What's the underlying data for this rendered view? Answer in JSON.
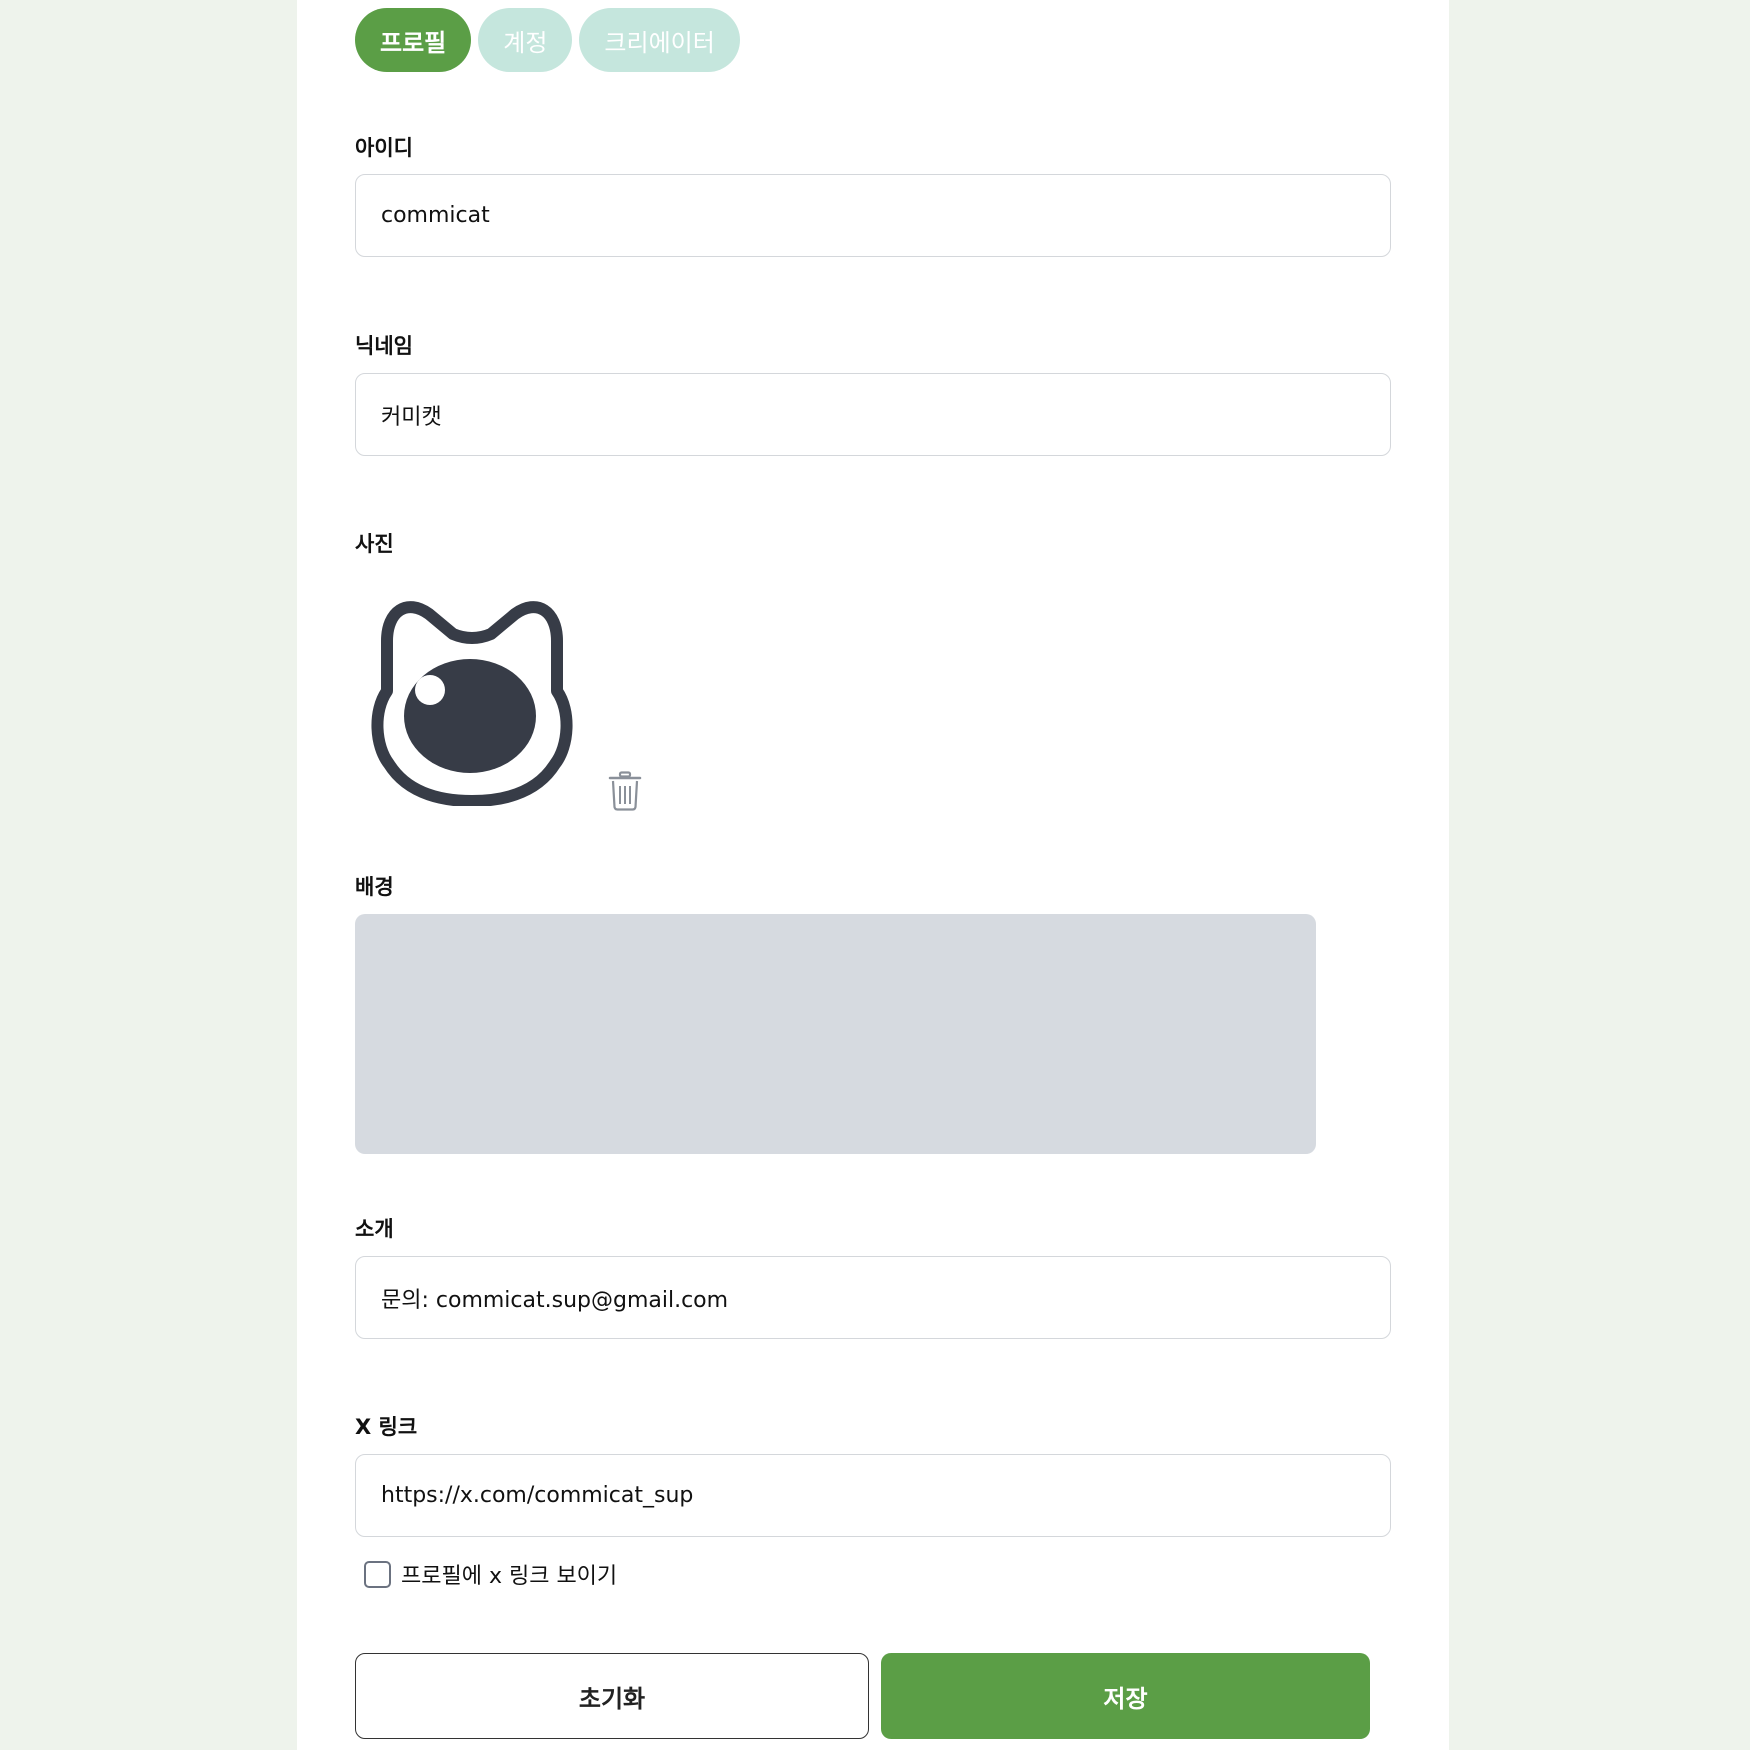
{
  "tabs": [
    {
      "label": "프로필",
      "active": true
    },
    {
      "label": "계정",
      "active": false
    },
    {
      "label": "크리에이터",
      "active": false
    }
  ],
  "fields": {
    "id": {
      "label": "아이디",
      "value": "commicat"
    },
    "nickname": {
      "label": "닉네임",
      "value": "커미캣"
    },
    "photo": {
      "label": "사진"
    },
    "background": {
      "label": "배경"
    },
    "intro": {
      "label": "소개",
      "value": "문의: commicat.sup@gmail.com"
    },
    "x_link": {
      "label": "X 링크",
      "value": "https://x.com/commicat_sup"
    }
  },
  "checkbox": {
    "label": "프로필에 x 링크 보이기",
    "checked": false
  },
  "buttons": {
    "reset": "초기화",
    "save": "저장"
  },
  "colors": {
    "accent": "#5b9e46",
    "tab_inactive": "#c5e6dd",
    "background_placeholder": "#d6dae0",
    "page_background": "#eef3ec"
  },
  "icons": {
    "avatar": "cat-face-icon",
    "delete": "trash-icon"
  }
}
